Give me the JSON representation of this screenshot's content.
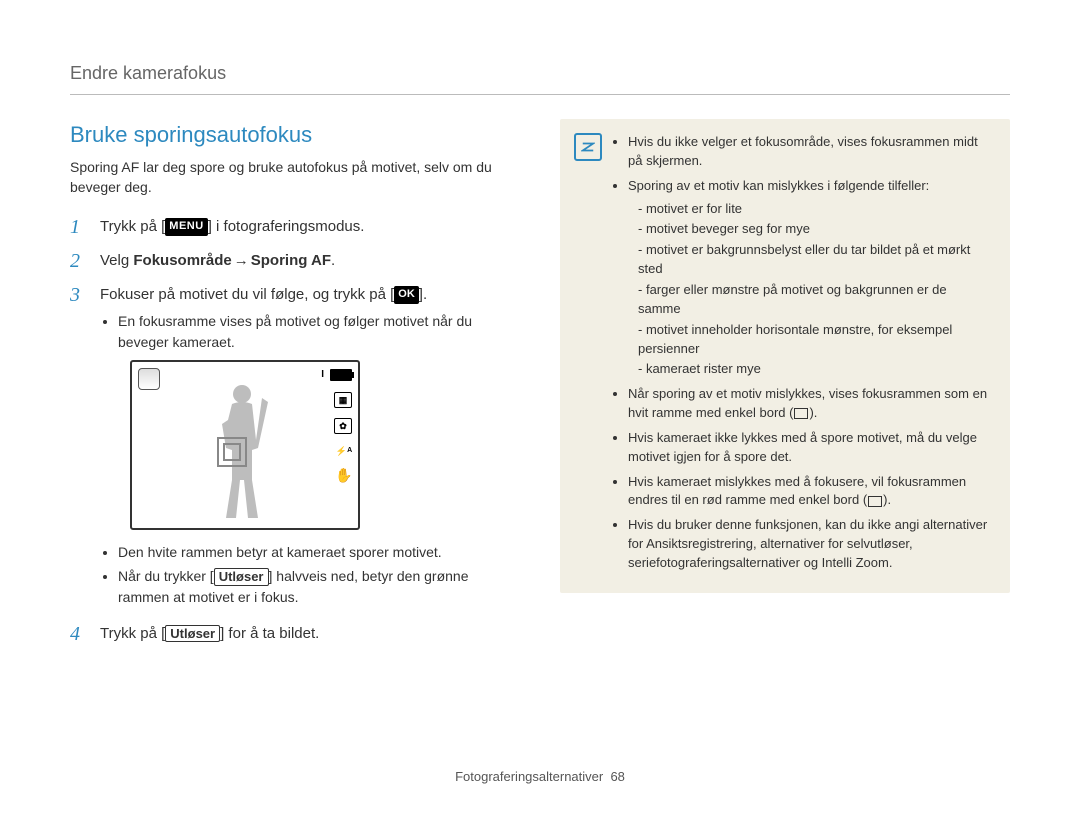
{
  "header": {
    "title": "Endre kamerafokus"
  },
  "section": {
    "title": "Bruke sporingsautofokus",
    "intro": "Sporing AF lar deg spore og bruke autofokus på motivet, selv om du beveger deg."
  },
  "steps": {
    "s1_a": "Trykk på [",
    "s1_b": "] i fotograferingsmodus.",
    "menu_label": "MENU",
    "s2_a": "Velg ",
    "s2_b": "Fokusområde",
    "s2_c": " → ",
    "s2_d": "Sporing AF",
    "s2_e": ".",
    "s3_a": "Fokuser på motivet du vil følge, og trykk på [",
    "s3_b": "].",
    "ok_label": "OK",
    "s3_bullet1": "En fokusramme vises på motivet og følger motivet når du beveger kameraet.",
    "s3_bullet2": "Den hvite rammen betyr at kameraet sporer motivet.",
    "s3_bullet3_a": "Når du trykker [",
    "s3_bullet3_shutter": "Utløser",
    "s3_bullet3_b": "] halvveis ned, betyr den grønne rammen at motivet er i fokus.",
    "s4_a": "Trykk på [",
    "s4_shutter": "Utløser",
    "s4_b": "] for å ta bildet."
  },
  "preview": {
    "bar_indicator": "I"
  },
  "note": {
    "b1": "Hvis du ikke velger et fokusområde, vises fokusrammen midt på skjermen.",
    "b2": "Sporing av et motiv kan mislykkes i følgende tilfeller:",
    "b2_s1": "motivet er for lite",
    "b2_s2": "motivet beveger seg for mye",
    "b2_s3": "motivet er bakgrunnsbelyst eller du tar bildet på et mørkt sted",
    "b2_s4": "farger eller mønstre på motivet og bakgrunnen er de samme",
    "b2_s5": "motivet inneholder horisontale mønstre, for eksempel persienner",
    "b2_s6": "kameraet rister mye",
    "b3_a": "Når sporing av et motiv mislykkes, vises fokusrammen som en hvit ramme med enkel bord (",
    "b3_b": ").",
    "b4": "Hvis kameraet ikke lykkes med å spore motivet, må du velge motivet igjen for å spore det.",
    "b5_a": "Hvis kameraet mislykkes med å fokusere, vil fokusrammen endres til en rød ramme med enkel bord (",
    "b5_b": ").",
    "b6": "Hvis du bruker denne funksjonen, kan du ikke angi alternativer for Ansiktsregistrering, alternativer for selvutløser, seriefotograferingsalternativer og Intelli Zoom."
  },
  "footer": {
    "section": "Fotograferingsalternativer",
    "page": "68"
  }
}
